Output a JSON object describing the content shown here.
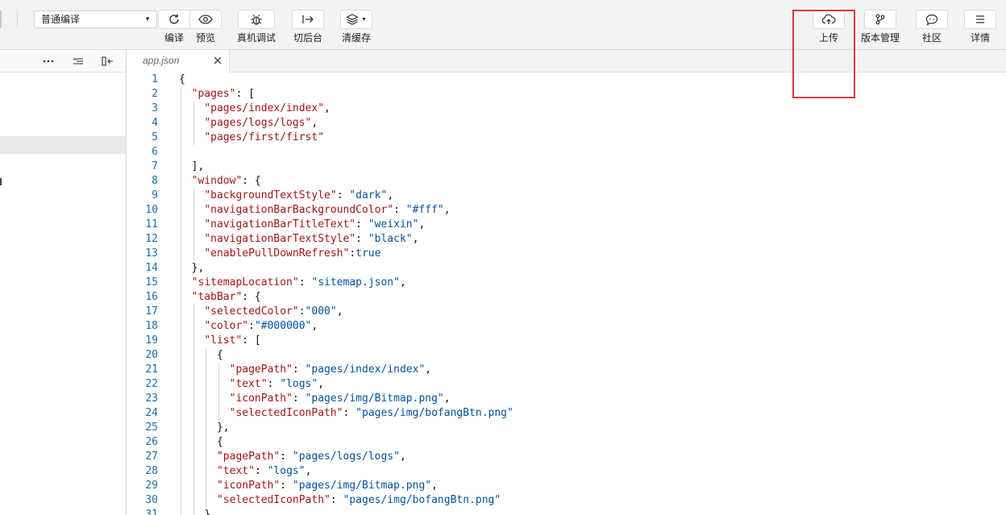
{
  "toolbar": {
    "compile_mode": "普通编译",
    "tools": {
      "compile": "编译",
      "preview": "预览",
      "debug": "真机调试",
      "background": "切后台",
      "clear_cache": "清缓存",
      "upload": "上传",
      "version": "版本管理",
      "community": "社区",
      "details": "详情"
    }
  },
  "editor": {
    "tab_name": "app.json",
    "lines": [
      {
        "n": "1",
        "indent": 0,
        "parts": [
          [
            "p",
            "{"
          ]
        ]
      },
      {
        "n": "2",
        "indent": 1,
        "parts": [
          [
            "k",
            "\"pages\""
          ],
          [
            "p",
            ": ["
          ]
        ]
      },
      {
        "n": "3",
        "indent": 2,
        "parts": [
          [
            "k",
            "\"pages/index/index\""
          ],
          [
            "p",
            ","
          ]
        ]
      },
      {
        "n": "4",
        "indent": 2,
        "parts": [
          [
            "k",
            "\"pages/logs/logs\""
          ],
          [
            "p",
            ","
          ]
        ]
      },
      {
        "n": "5",
        "indent": 2,
        "parts": [
          [
            "k",
            "\"pages/first/first\""
          ]
        ]
      },
      {
        "n": "6",
        "indent": 1,
        "parts": []
      },
      {
        "n": "7",
        "indent": 1,
        "parts": [
          [
            "p",
            "],"
          ]
        ]
      },
      {
        "n": "8",
        "indent": 1,
        "parts": [
          [
            "k",
            "\"window\""
          ],
          [
            "p",
            ": {"
          ]
        ]
      },
      {
        "n": "9",
        "indent": 2,
        "parts": [
          [
            "k",
            "\"backgroundTextStyle\""
          ],
          [
            "p",
            ": "
          ],
          [
            "s",
            "\"dark\""
          ],
          [
            "p",
            ","
          ]
        ]
      },
      {
        "n": "10",
        "indent": 2,
        "parts": [
          [
            "k",
            "\"navigationBarBackgroundColor\""
          ],
          [
            "p",
            ": "
          ],
          [
            "s",
            "\"#fff\""
          ],
          [
            "p",
            ","
          ]
        ]
      },
      {
        "n": "11",
        "indent": 2,
        "parts": [
          [
            "k",
            "\"navigationBarTitleText\""
          ],
          [
            "p",
            ": "
          ],
          [
            "s",
            "\"weixin\""
          ],
          [
            "p",
            ","
          ]
        ]
      },
      {
        "n": "12",
        "indent": 2,
        "parts": [
          [
            "k",
            "\"navigationBarTextStyle\""
          ],
          [
            "p",
            ": "
          ],
          [
            "s",
            "\"black\""
          ],
          [
            "p",
            ","
          ]
        ]
      },
      {
        "n": "13",
        "indent": 2,
        "parts": [
          [
            "k",
            "\"enablePullDownRefresh\""
          ],
          [
            "p",
            ":"
          ],
          [
            "s",
            "true"
          ]
        ]
      },
      {
        "n": "14",
        "indent": 1,
        "parts": [
          [
            "p",
            "},"
          ]
        ]
      },
      {
        "n": "15",
        "indent": 1,
        "parts": [
          [
            "k",
            "\"sitemapLocation\""
          ],
          [
            "p",
            ": "
          ],
          [
            "s",
            "\"sitemap.json\""
          ],
          [
            "p",
            ","
          ]
        ]
      },
      {
        "n": "16",
        "indent": 1,
        "parts": [
          [
            "k",
            "\"tabBar\""
          ],
          [
            "p",
            ": {"
          ]
        ]
      },
      {
        "n": "17",
        "indent": 2,
        "parts": [
          [
            "k",
            "\"selectedColor\""
          ],
          [
            "p",
            ":"
          ],
          [
            "s",
            "\"000\""
          ],
          [
            "p",
            ","
          ]
        ]
      },
      {
        "n": "18",
        "indent": 2,
        "parts": [
          [
            "k",
            "\"color\""
          ],
          [
            "p",
            ":"
          ],
          [
            "s",
            "\"#000000\""
          ],
          [
            "p",
            ","
          ]
        ]
      },
      {
        "n": "19",
        "indent": 2,
        "parts": [
          [
            "k",
            "\"list\""
          ],
          [
            "p",
            ": ["
          ]
        ]
      },
      {
        "n": "20",
        "indent": 3,
        "parts": [
          [
            "p",
            "{"
          ]
        ]
      },
      {
        "n": "21",
        "indent": 4,
        "parts": [
          [
            "k",
            "\"pagePath\""
          ],
          [
            "p",
            ": "
          ],
          [
            "s",
            "\"pages/index/index\""
          ],
          [
            "p",
            ","
          ]
        ]
      },
      {
        "n": "22",
        "indent": 4,
        "parts": [
          [
            "k",
            "\"text\""
          ],
          [
            "p",
            ": "
          ],
          [
            "s",
            "\"logs\""
          ],
          [
            "p",
            ","
          ]
        ]
      },
      {
        "n": "23",
        "indent": 4,
        "parts": [
          [
            "k",
            "\"iconPath\""
          ],
          [
            "p",
            ": "
          ],
          [
            "s",
            "\"pages/img/Bitmap.png\""
          ],
          [
            "p",
            ","
          ]
        ]
      },
      {
        "n": "24",
        "indent": 4,
        "parts": [
          [
            "k",
            "\"selectedIconPath\""
          ],
          [
            "p",
            ": "
          ],
          [
            "s",
            "\"pages/img/bofangBtn.png\""
          ]
        ]
      },
      {
        "n": "25",
        "indent": 3,
        "parts": [
          [
            "p",
            "},"
          ]
        ]
      },
      {
        "n": "26",
        "indent": 3,
        "parts": [
          [
            "p",
            "{"
          ]
        ]
      },
      {
        "n": "27",
        "indent": 3,
        "parts": [
          [
            "k",
            "\"pagePath\""
          ],
          [
            "p",
            ": "
          ],
          [
            "s",
            "\"pages/logs/logs\""
          ],
          [
            "p",
            ","
          ]
        ]
      },
      {
        "n": "28",
        "indent": 3,
        "parts": [
          [
            "k",
            "\"text\""
          ],
          [
            "p",
            ": "
          ],
          [
            "s",
            "\"logs\""
          ],
          [
            "p",
            ","
          ]
        ]
      },
      {
        "n": "29",
        "indent": 3,
        "parts": [
          [
            "k",
            "\"iconPath\""
          ],
          [
            "p",
            ": "
          ],
          [
            "s",
            "\"pages/img/Bitmap.png\""
          ],
          [
            "p",
            ","
          ]
        ]
      },
      {
        "n": "30",
        "indent": 3,
        "parts": [
          [
            "k",
            "\"selectedIconPath\""
          ],
          [
            "p",
            ": "
          ],
          [
            "s",
            "\"pages/img/bofangBtn.png\""
          ]
        ]
      },
      {
        "n": "31",
        "indent": 2,
        "parts": [
          [
            "p",
            "}"
          ]
        ]
      }
    ]
  }
}
